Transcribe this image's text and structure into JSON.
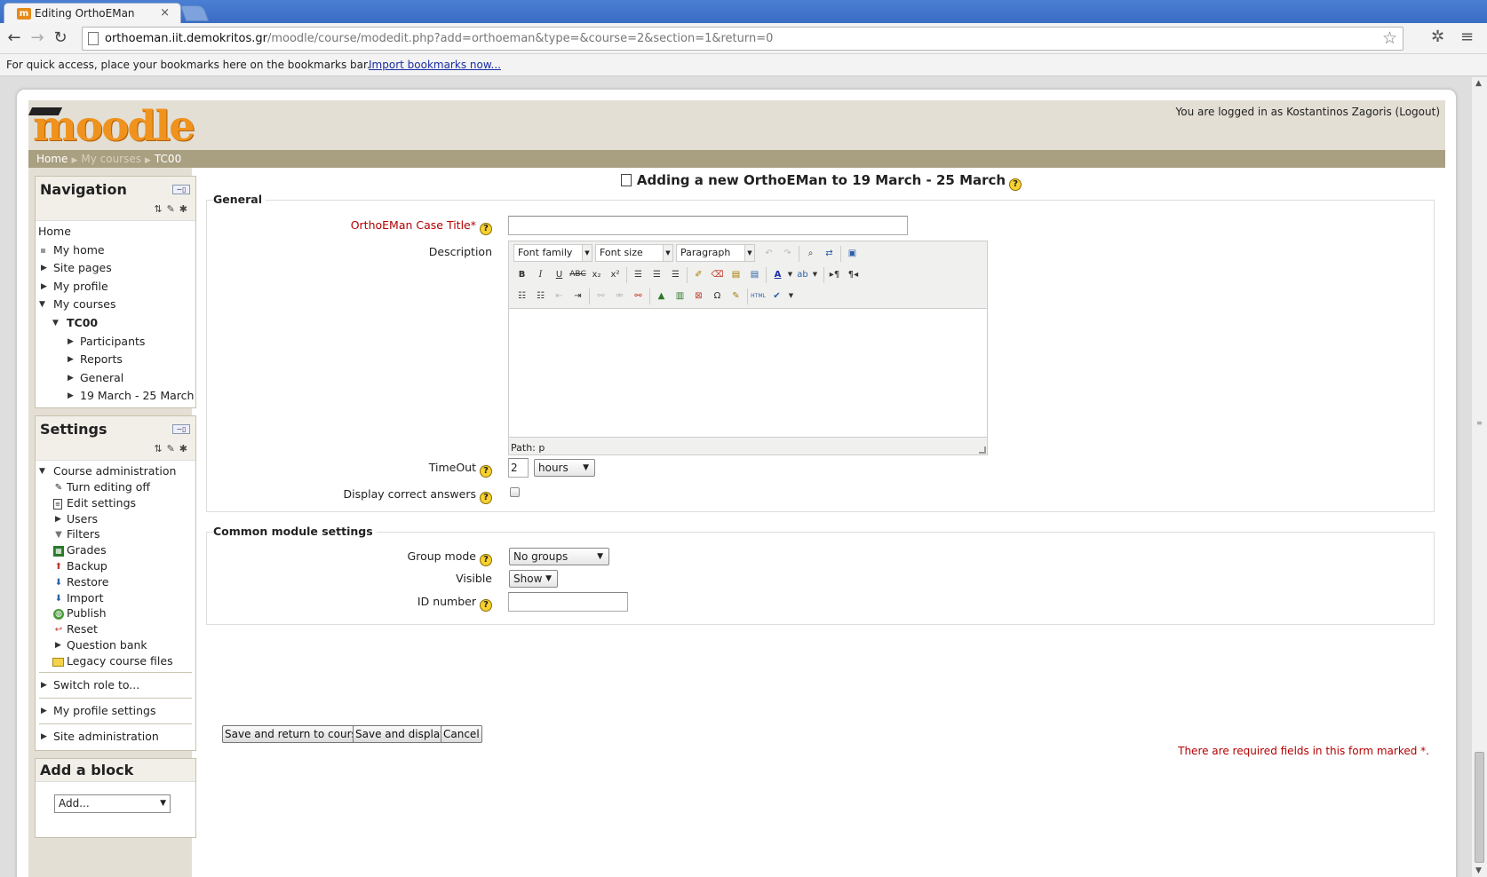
{
  "browser": {
    "tab_title": "Editing OrthoEMan",
    "url_host": "orthoeman.iit.demokritos.gr",
    "url_path": "/moodle/course/modedit.php?add=orthoeman&type=&course=2&section=1&return=0",
    "bookmarks_message": "For quick access, place your bookmarks here on the bookmarks bar.",
    "bookmarks_link": "Import bookmarks now..."
  },
  "header": {
    "logo_text": "moodle",
    "login_info": "You are logged in as Kostantinos Zagoris (Logout)"
  },
  "breadcrumb": [
    "Home",
    "My courses",
    "TC00"
  ],
  "navigation": {
    "title": "Navigation",
    "items": [
      {
        "label": "Home"
      },
      {
        "label": "My home"
      },
      {
        "label": "Site pages"
      },
      {
        "label": "My profile"
      },
      {
        "label": "My courses"
      },
      {
        "label": "TC00"
      },
      {
        "label": "Participants"
      },
      {
        "label": "Reports"
      },
      {
        "label": "General"
      },
      {
        "label": "19 March - 25 March"
      }
    ]
  },
  "settings": {
    "title": "Settings",
    "items": [
      {
        "label": "Course administration"
      },
      {
        "label": "Turn editing off"
      },
      {
        "label": "Edit settings"
      },
      {
        "label": "Users"
      },
      {
        "label": "Filters"
      },
      {
        "label": "Grades"
      },
      {
        "label": "Backup"
      },
      {
        "label": "Restore"
      },
      {
        "label": "Import"
      },
      {
        "label": "Publish"
      },
      {
        "label": "Reset"
      },
      {
        "label": "Question bank"
      },
      {
        "label": "Legacy course files"
      }
    ],
    "switch_role": "Switch role to...",
    "profile_settings": "My profile settings",
    "site_admin": "Site administration"
  },
  "add_block": {
    "title": "Add a block",
    "select_value": "Add..."
  },
  "main": {
    "heading": "Adding a new OrthoEMan to 19 March - 25 March",
    "general_legend": "General",
    "case_title_label": "OrthoEMan Case Title",
    "description_label": "Description",
    "editor": {
      "font_family": "Font family",
      "font_size": "Font size",
      "format": "Paragraph",
      "path": "Path: p"
    },
    "timeout_label": "TimeOut",
    "timeout_value": "2",
    "timeout_unit": "hours",
    "display_answers_label": "Display correct answers",
    "common_legend": "Common module settings",
    "group_mode_label": "Group mode",
    "group_mode_value": "No groups",
    "visible_label": "Visible",
    "visible_value": "Show",
    "id_number_label": "ID number",
    "save_return": "Save and return to course",
    "save_display": "Save and display",
    "cancel": "Cancel",
    "required_note": "There are required fields in this form marked"
  }
}
